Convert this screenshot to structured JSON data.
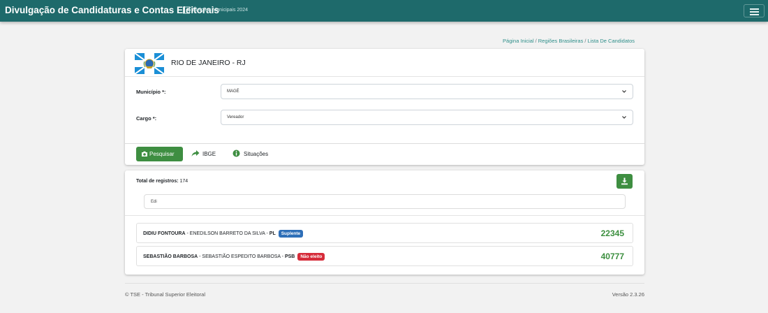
{
  "header": {
    "title": "Divulgação de Candidaturas e Contas Eleitorais",
    "subtitle": "Eleições Municipais 2024",
    "edit_icon": "edit-icon",
    "menu_icon": "hamburger-menu-icon"
  },
  "breadcrumb": {
    "items": [
      "Página Inicial",
      "Regiões Brasileiras",
      "Lista De Candidatos"
    ],
    "separator": "/"
  },
  "state": {
    "name": "RIO DE JANEIRO - RJ",
    "flag_icon": "rio-de-janeiro-flag"
  },
  "form": {
    "municipio_label": "Município *:",
    "municipio_value": "MAGÉ",
    "cargo_label": "Cargo *:",
    "cargo_value": "Vereador"
  },
  "actions": {
    "pesquisar": "Pesquisar",
    "ibge": "IBGE",
    "situacoes": "Situações"
  },
  "results": {
    "total_label": "Total de registros:",
    "total_value": "174",
    "filter_value": "Edi",
    "download_icon": "download-icon",
    "candidates": [
      {
        "urn_name": "DIDIU FONTOURA",
        "full_name": "ENEDILSON BARRETO DA SILVA",
        "party": "PL",
        "status": "Suplente",
        "number": "22345"
      },
      {
        "urn_name": "SEBASTIÃO BARBOSA",
        "full_name": "SEBASTIÃO ESPEDITO BARBOSA",
        "party": "PSB",
        "status": "Não eleito",
        "number": "40777"
      }
    ]
  },
  "footer": {
    "left": "© TSE - Tribunal Superior Eleitoral",
    "right": "Versão 2.3.26"
  },
  "colors": {
    "navbar": "#1e6a6b",
    "primary_green": "#3e8e41",
    "badge_suplente": "#2e6fb8",
    "badge_nao_eleito": "#d62c3a",
    "number_green": "#3c8f3f"
  }
}
